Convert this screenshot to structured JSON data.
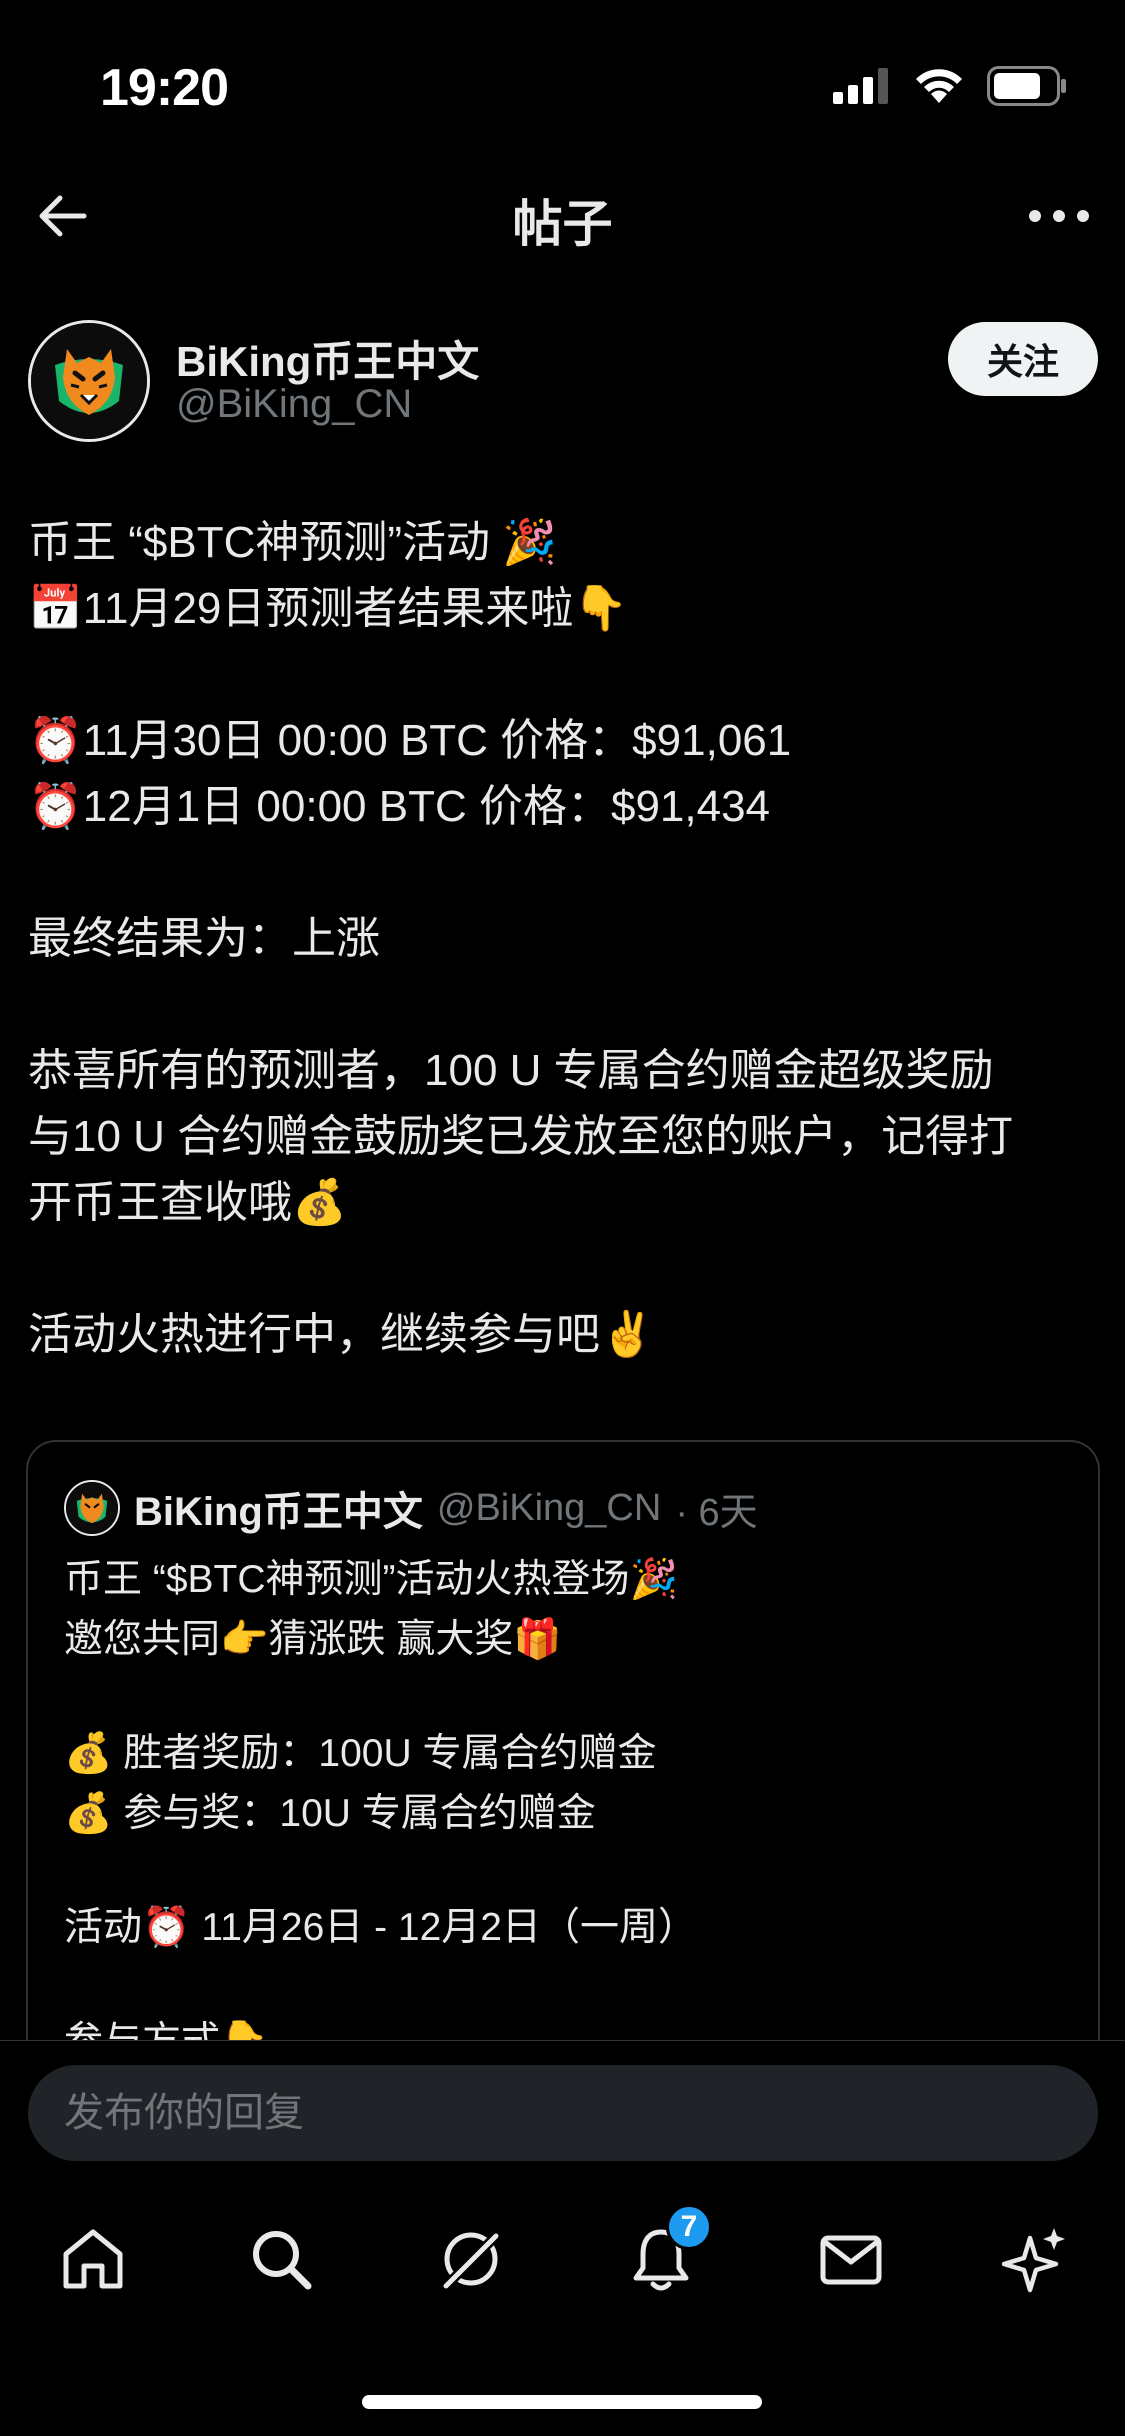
{
  "status_bar": {
    "time": "19:20"
  },
  "header": {
    "title": "帖子"
  },
  "post": {
    "author_name": "BiKing币王中文",
    "author_handle": "@BiKing_CN",
    "follow_label": "关注",
    "lines": [
      "币王 “$BTC神预测”活动 🎉",
      "📅11月29日预测者结果来啦👇",
      "",
      "⏰11月30日 00:00 BTC 价格：$91,061",
      "⏰12月1日 00:00 BTC 价格：$91,434",
      "",
      "最终结果为：上涨",
      "",
      "恭喜所有的预测者，100 U 专属合约赠金超级奖励",
      "与10 U 合约赠金鼓励奖已发放至您的账户，记得打",
      "开币王查收哦💰",
      "",
      "活动火热进行中，继续参与吧✌️"
    ]
  },
  "quote": {
    "author_name": "BiKing币王中文",
    "author_handle": "@BiKing_CN",
    "time": "· 6天",
    "lines": [
      "币王 “$BTC神预测”活动火热登场🎉",
      "邀您共同👉猜涨跌 赢大奖🎁",
      "",
      "💰 胜者奖励：100U 专属合约赠金",
      "💰 参与奖：10U 专属合约赠金",
      "",
      "活动⏰ 11月26日 - 12月2日（一周）",
      "",
      "参与方式👇"
    ]
  },
  "reply": {
    "placeholder": "发布你的回复"
  },
  "tabs": {
    "notifications_badge": "7"
  },
  "colors": {
    "accent": "#1d9bf0",
    "background": "#000000",
    "text": "#e7e9ea",
    "secondary_text": "#71767b"
  }
}
